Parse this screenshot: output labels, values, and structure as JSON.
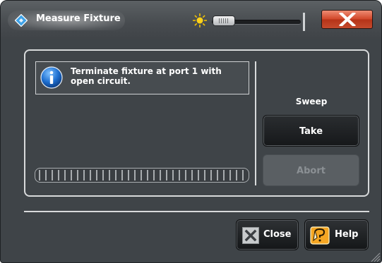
{
  "window": {
    "title": "Measure Fixture",
    "opacity_slider_fraction": 0.0
  },
  "instruction": {
    "line1": "Terminate fixture at port 1 with",
    "line2": "open circuit."
  },
  "progress": {
    "fraction": 0.0
  },
  "sweep": {
    "label": "Sweep",
    "take_label": "Take",
    "abort_label": "Abort"
  },
  "footer": {
    "close_label": "Close",
    "help_label": "Help"
  },
  "colors": {
    "window_bg": "#3f4448",
    "accent_close": "#d2472a",
    "help_icon_bg": "#f5a623",
    "info_icon": "#1e6fd0"
  },
  "icons": {
    "app": "rs-diamond-icon",
    "brightness": "sun-icon",
    "window_close": "close-x-icon",
    "info": "info-icon",
    "close_button": "close-x-icon",
    "help_button": "help-question-icon",
    "resize": "resize-grip-icon"
  }
}
